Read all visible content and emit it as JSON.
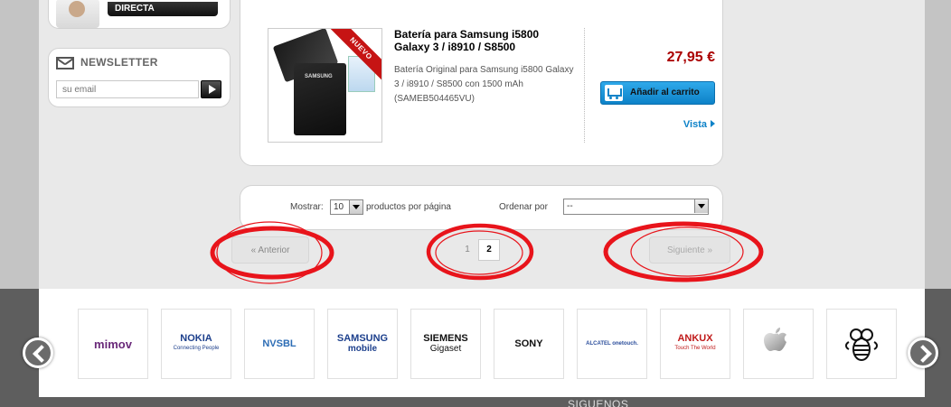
{
  "sidebar": {
    "promo": {
      "label": "DIRECTA"
    },
    "newsletter": {
      "title": "NEWSLETTER",
      "placeholder": "su email"
    }
  },
  "product": {
    "badge": "NUEVO",
    "battery_label": "SAMSUNG",
    "name": "Batería para Samsung i5800 Galaxy 3 / i8910 / S8500",
    "description": "Batería Original para Samsung i5800 Galaxy  3 /  i8910 / S8500 con 1500 mAh (SAMEB504465VU)",
    "price": "27,95 €",
    "add_to_cart": "Añadir al carrito",
    "view": "Vista"
  },
  "filters": {
    "show_label": "Mostrar:",
    "show_value": "10",
    "per_page_label": "productos por página",
    "order_label": "Ordenar por",
    "order_value": "--"
  },
  "pagination": {
    "prev": "« Anterior",
    "pages": [
      "1",
      "2"
    ],
    "current": "2",
    "next": "Siguiente »"
  },
  "brands": [
    {
      "name": "mimov",
      "sub": "",
      "color": "#6a2a7a"
    },
    {
      "name": "NOKIA",
      "sub": "Connecting People",
      "color": "#1c3f8c"
    },
    {
      "name": "NVSBL",
      "sub": "",
      "color": "#2d6db5"
    },
    {
      "name": "SAMSUNG",
      "sub": "mobile",
      "color": "#1c3f8c"
    },
    {
      "name": "SIEMENS",
      "sub": "Gigaset",
      "color": "#111111"
    },
    {
      "name": "SONY",
      "sub": "",
      "color": "#111111"
    },
    {
      "name": "ALCATEL onetouch.",
      "sub": "",
      "color": "#2a4d9b"
    },
    {
      "name": "ANKUX",
      "sub": "Touch The World",
      "color": "#c01a1a"
    },
    {
      "name": "apple",
      "sub": "",
      "color": "#999999"
    },
    {
      "name": "bee",
      "sub": "",
      "color": "#111111"
    }
  ],
  "footer": {
    "follow": "SIGUENOS"
  },
  "colors": {
    "price": "#aa0000",
    "accent": "#0d82c8",
    "highlight": "#e8141b"
  }
}
